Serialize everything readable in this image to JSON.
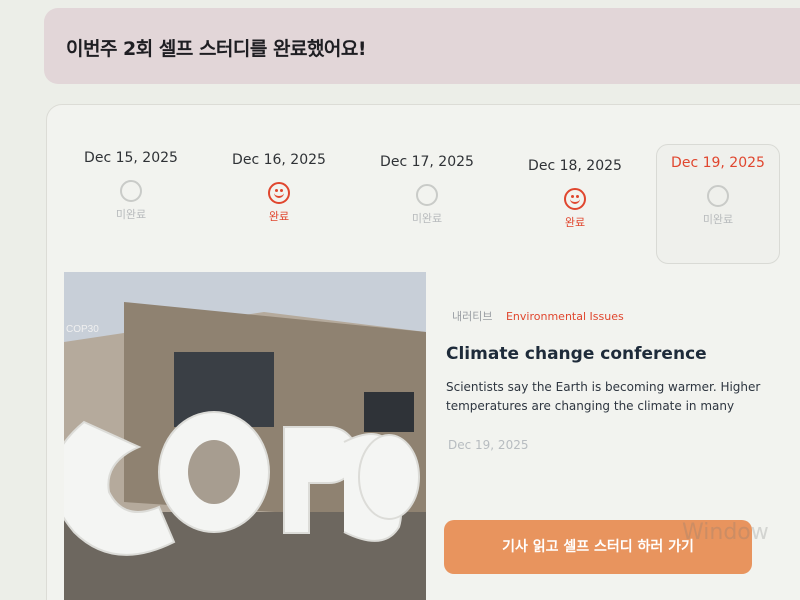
{
  "banner": {
    "title": "이번주 2회 셀프 스터디를 완료했어요!"
  },
  "week": [
    {
      "date": "Dec 15, 2025",
      "status": "미완료",
      "done": false
    },
    {
      "date": "Dec 16, 2025",
      "status": "완료",
      "done": true
    },
    {
      "date": "Dec 17, 2025",
      "status": "미완료",
      "done": false
    },
    {
      "date": "Dec 18, 2025",
      "status": "완료",
      "done": true
    },
    {
      "date": "Dec 19, 2025",
      "status": "미완료",
      "done": false,
      "today": true
    }
  ],
  "article": {
    "category": "내러티브",
    "topic": "Environmental Issues",
    "title": "Climate change conference",
    "description": "Scientists say the Earth is becoming warmer. Higher temperatures are changing the climate in many",
    "date": "Dec 19, 2025",
    "image_text": "COP30"
  },
  "cta": {
    "label": "기사 읽고 셀프 스터디 하러 가기"
  },
  "watermark": "Window"
}
